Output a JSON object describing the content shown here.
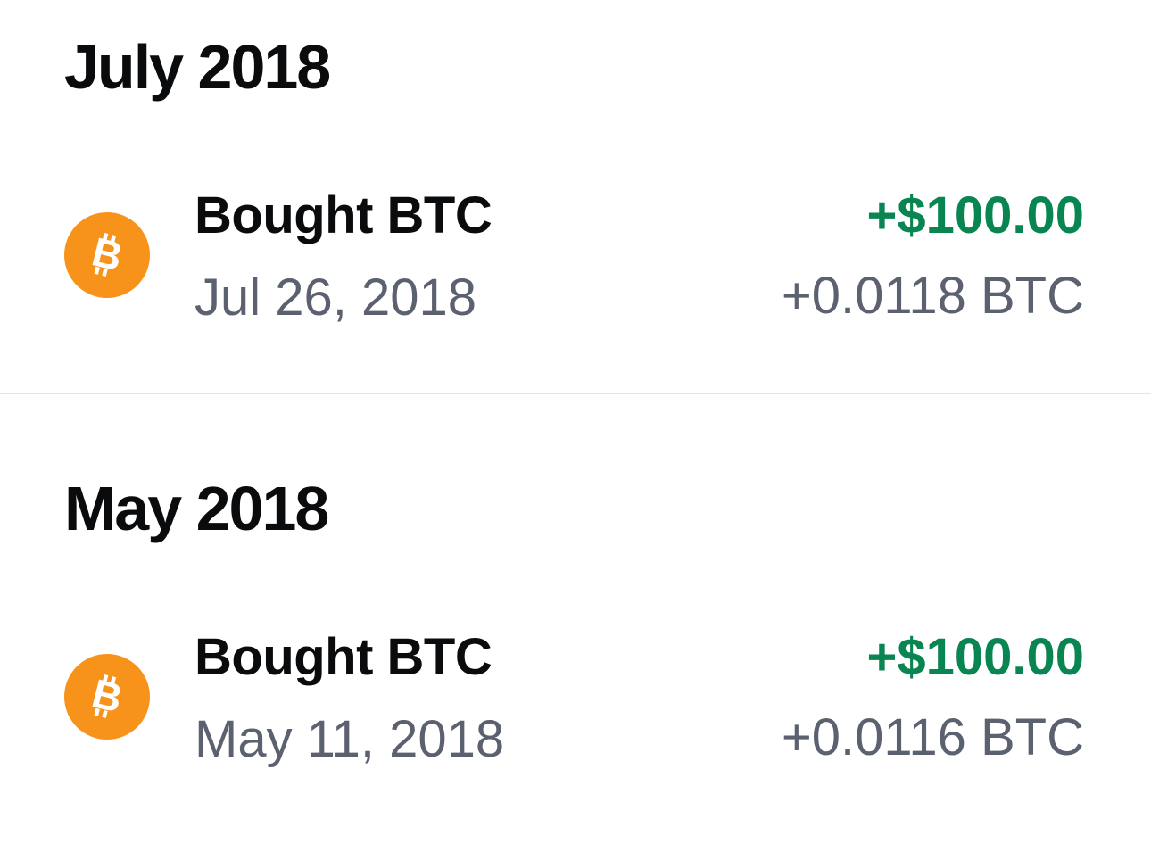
{
  "colors": {
    "positive": "#098551",
    "muted": "#5b616e",
    "primary_text": "#0a0b0d",
    "bitcoin_orange": "#f7931a",
    "divider": "#e3e5e8"
  },
  "sections": [
    {
      "title": "July 2018",
      "transactions": [
        {
          "icon": "bitcoin-icon",
          "title": "Bought BTC",
          "date": "Jul 26, 2018",
          "amount_fiat": "+$100.00",
          "amount_crypto": "+0.0118 BTC"
        }
      ]
    },
    {
      "title": "May 2018",
      "transactions": [
        {
          "icon": "bitcoin-icon",
          "title": "Bought BTC",
          "date": "May 11, 2018",
          "amount_fiat": "+$100.00",
          "amount_crypto": "+0.0116 BTC"
        }
      ]
    }
  ]
}
